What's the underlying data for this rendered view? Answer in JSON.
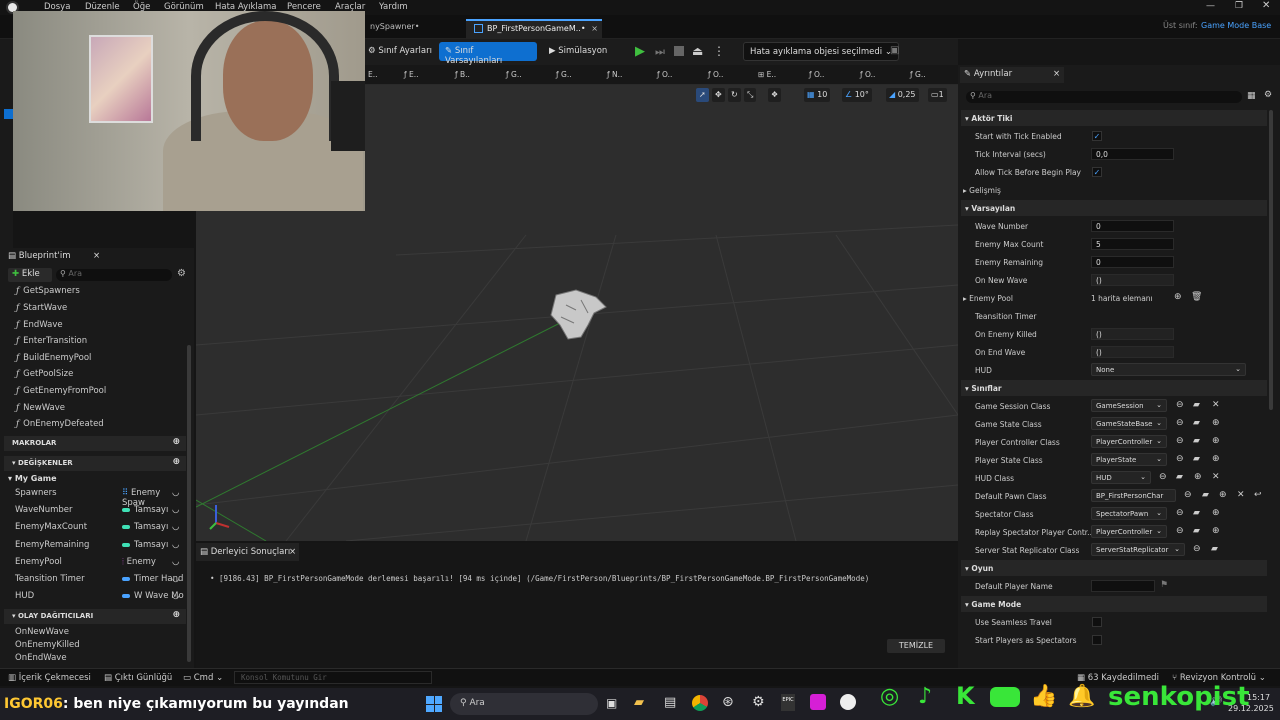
{
  "menu": [
    "Dosya",
    "Düzenle",
    "Öğe",
    "Görünüm",
    "Hata Ayıklama",
    "Pencere",
    "Araçlar",
    "Yardım"
  ],
  "tabs": {
    "spawner": "nySpawner•",
    "active": "BP_FirstPersonGameM..•",
    "close": "×"
  },
  "parent_class": {
    "label": "Üst sınıf:",
    "value": "Game Mode Base"
  },
  "toolbar": {
    "class_settings": "Sınıf Ayarları",
    "class_defaults": "Sınıf Varsayılanları",
    "simulation": "Simülasyon",
    "debug_object": "Hata ayıklama objesi seçilmedi"
  },
  "graph_tabs": [
    "E..",
    "E..",
    "B..",
    "G..",
    "G..",
    "N..",
    "O..",
    "O..",
    "E..",
    "O..",
    "O..",
    "G.."
  ],
  "viewport": {
    "grid": "10",
    "angle": "10°",
    "scale": "0,25",
    "camera": "1"
  },
  "my_blueprint": {
    "title": "Blueprint'im",
    "add": "Ekle",
    "search_placeholder": "Ara",
    "functions": [
      "GetSpawners",
      "StartWave",
      "EndWave",
      "EnterTransition",
      "BuildEnemyPool",
      "GetPoolSize",
      "GetEnemyFromPool",
      "NewWave",
      "OnEnemyDefeated"
    ],
    "macros": "MAKROLAR",
    "variables_header": "DEĞİŞKENLER",
    "category": "My Game",
    "variables": [
      {
        "name": "Spawners",
        "type": "Enemy Spaw",
        "color": "#4aa3ff"
      },
      {
        "name": "WaveNumber",
        "type": "Tamsayı",
        "color": "#3fe0b5"
      },
      {
        "name": "EnemyMaxCount",
        "type": "Tamsayı",
        "color": "#3fe0b5"
      },
      {
        "name": "EnemyRemaining",
        "type": "Tamsayı",
        "color": "#3fe0b5"
      },
      {
        "name": "EnemyPool",
        "type": "Enemy",
        "color": "#c050d0"
      },
      {
        "name": "Teansition Timer",
        "type": "Timer Hand",
        "color": "#4aa3ff"
      },
      {
        "name": "HUD",
        "type": "W Wave Mo",
        "color": "#4aa3ff"
      }
    ],
    "dispatchers_header": "OLAY DAĞITICILARI",
    "dispatchers": [
      "OnNewWave",
      "OnEnemyKilled",
      "OnEndWave"
    ]
  },
  "compiler": {
    "tab": "Derleyici Sonuçları",
    "message": "[9186.43] BP_FirstPersonGameMode derlemesi başarılı! [94 ms içinde] (/Game/FirstPerson/Blueprints/BP_FirstPersonGameMode.BP_FirstPersonGameMode)",
    "clear": "TEMİZLE"
  },
  "details": {
    "title": "Ayrıntılar",
    "search_placeholder": "Ara",
    "actor_tick": {
      "header": "Aktör Tiki",
      "start_tick": "Start with Tick Enabled",
      "tick_interval": "Tick Interval (secs)",
      "tick_interval_value": "0,0",
      "allow_tick": "Allow Tick Before Begin Play",
      "advanced": "Gelişmiş"
    },
    "defaults": {
      "header": "Varsayılan",
      "wave_number": "Wave Number",
      "wave_number_value": "0",
      "enemy_max": "Enemy Max Count",
      "enemy_max_value": "5",
      "enemy_remaining": "Enemy Remaining",
      "enemy_remaining_value": "0",
      "on_new_wave": "On New Wave",
      "empty": "()",
      "enemy_pool": "Enemy Pool",
      "enemy_pool_value": "1 harita elemanı",
      "transition": "Teansition Timer",
      "on_enemy_killed": "On Enemy Killed",
      "on_end_wave": "On End Wave",
      "hud": "HUD",
      "hud_value": "None"
    },
    "classes": {
      "header": "Sınıflar",
      "rows": [
        {
          "label": "Game Session Class",
          "value": "GameSession"
        },
        {
          "label": "Game State Class",
          "value": "GameStateBase"
        },
        {
          "label": "Player Controller Class",
          "value": "PlayerController"
        },
        {
          "label": "Player State Class",
          "value": "PlayerState"
        },
        {
          "label": "HUD Class",
          "value": "HUD"
        },
        {
          "label": "Default Pawn Class",
          "value": "BP_FirstPersonChar"
        },
        {
          "label": "Spectator Class",
          "value": "SpectatorPawn"
        },
        {
          "label": "Replay Spectator Player Contr...",
          "value": "PlayerController"
        },
        {
          "label": "Server Stat Replicator Class",
          "value": "ServerStatReplicator"
        }
      ]
    },
    "game": {
      "header": "Oyun",
      "default_player_name": "Default Player Name"
    },
    "game_mode": {
      "header": "Game Mode",
      "seamless": "Use Seamless Travel",
      "spectators": "Start Players as Spectators"
    }
  },
  "status": {
    "content_drawer": "İçerik Çekmecesi",
    "output_log": "Çıktı Günlüğü",
    "cmd": "Cmd",
    "console_placeholder": "Konsol Komutunu Gir",
    "saved": "63 Kaydedilmedi",
    "revision": "Revizyon Kontrolü"
  },
  "stream": {
    "username": "IGOR06",
    "chat": ": ben niye çıkamıyorum bu yayından",
    "brand": "senkopist"
  },
  "taskbar": {
    "search": "Ara",
    "time": "15:17",
    "date": "29.12.2025"
  }
}
